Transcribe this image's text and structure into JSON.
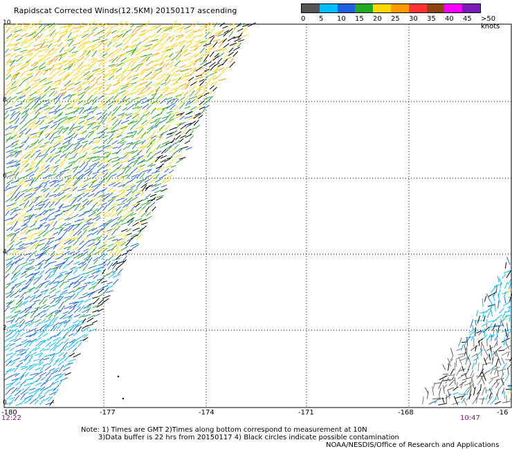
{
  "title": "Rapidscat Corrected Winds(12.5KM) 20150117 ascending",
  "colorbar": {
    "colors": [
      "#555555",
      "#00bfff",
      "#1e5fe0",
      "#22aa22",
      "#ffd700",
      "#ff9900",
      "#ff3333",
      "#8b4513",
      "#ff00ff",
      "#7a1ab8"
    ],
    "labels": [
      "0",
      "5",
      "10",
      "15",
      "20",
      "25",
      "30",
      "35",
      "40",
      "45",
      ">50 knots"
    ]
  },
  "x_axis": {
    "labels": [
      "-180",
      "-177",
      "-174",
      "-171",
      "-168",
      "-16"
    ]
  },
  "y_axis": {
    "labels": [
      "10",
      "8",
      "6",
      "4",
      "2",
      "0"
    ]
  },
  "times": {
    "left": "12:22",
    "right": "10:47"
  },
  "notes": {
    "line1": "Note: 1) Times are GMT 2)Times along bottom correspond to measurement at 10N",
    "line2": "3)Data buffer is 22 hrs from 20150117 4) Black circles indicate possible contamination",
    "line3": "NOAA/NESDIS/Office of Research and Applications"
  }
}
